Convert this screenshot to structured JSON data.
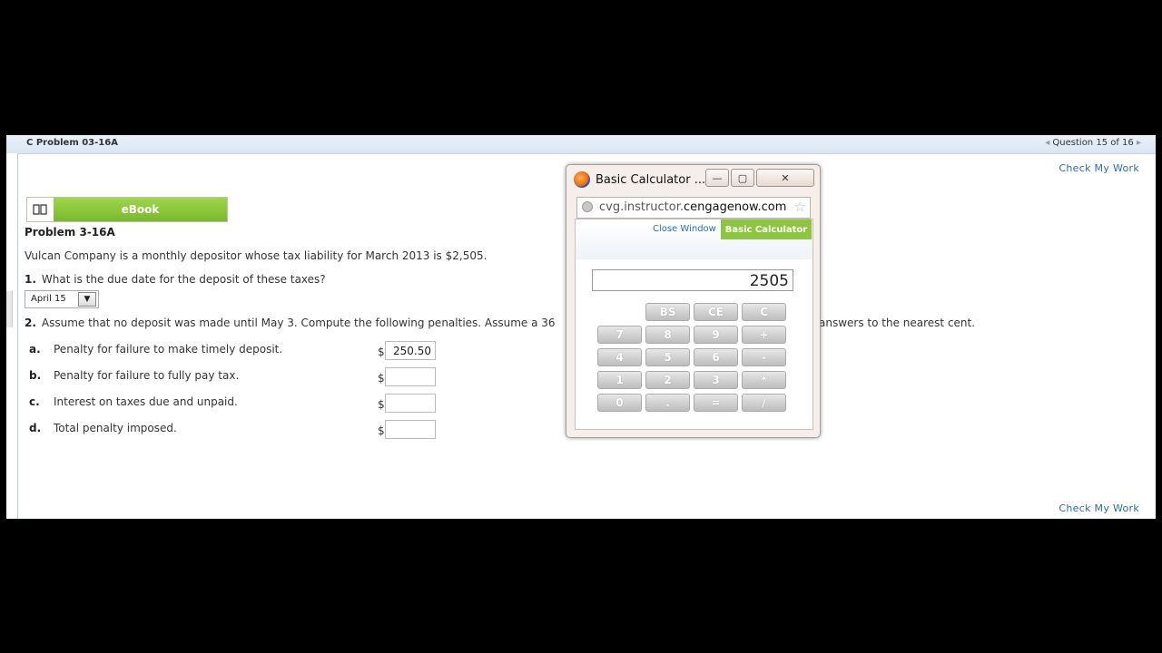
{
  "header": {
    "title": "C Problem 03-16A",
    "prev_arrow": "◂",
    "question_counter": "Question 15 of 16",
    "next_arrow": "▸"
  },
  "check_my_work": "Check My Work",
  "ebook": {
    "label": "eBook",
    "icon": "book-icon"
  },
  "problem": {
    "title": "Problem 3-16A",
    "statement": "Vulcan Company is a monthly depositor whose tax liability for March 2013 is $2,505.",
    "q1": {
      "number": "1.",
      "text": "What is the due date for the deposit of these taxes?",
      "selected": "April 15"
    },
    "q2": {
      "number": "2.",
      "text_left": "Assume that no deposit was made until May 3. Compute the following penalties. Assume a 36",
      "text_right": "answers to the nearest cent."
    },
    "rows": [
      {
        "letter": "a.",
        "label": "Penalty for failure to make timely deposit.",
        "currency": "$",
        "value": "250.50"
      },
      {
        "letter": "b.",
        "label": "Penalty for failure to fully pay tax.",
        "currency": "$",
        "value": ""
      },
      {
        "letter": "c.",
        "label": "Interest on taxes due and unpaid.",
        "currency": "$",
        "value": ""
      },
      {
        "letter": "d.",
        "label": "Total penalty imposed.",
        "currency": "$",
        "value": ""
      }
    ]
  },
  "popup": {
    "window_title": "Basic Calculator ...",
    "minimize": "—",
    "restore": "▢",
    "close": "✕",
    "url_host_prefix": "cvg.instructor.",
    "url_host_main": "cengagenow.com",
    "close_window": "Close Window",
    "tab_label": "Basic Calculator",
    "display_value": "2505",
    "keys": [
      [
        "BS",
        "CE",
        "C"
      ],
      [
        "7",
        "8",
        "9",
        "+"
      ],
      [
        "4",
        "5",
        "6",
        "-"
      ],
      [
        "1",
        "2",
        "3",
        "*"
      ],
      [
        "0",
        ".",
        "=",
        "/"
      ]
    ]
  },
  "colors": {
    "accent_green": "#8cc63e",
    "link_blue": "#2b6ca3",
    "header_blue": "#dbe7f2"
  }
}
